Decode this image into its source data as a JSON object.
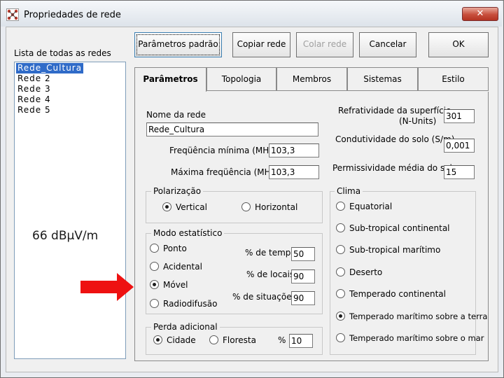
{
  "window": {
    "title": "Propriedades de rede",
    "close_label": "✕"
  },
  "sidebar": {
    "list_label": "Lista de todas as redes",
    "items": [
      "Rede_Cultura",
      "Rede 2",
      "Rede 3",
      "Rede 4",
      "Rede 5"
    ],
    "selected_index": 0
  },
  "toolbar": {
    "default_params": "Parâmetros padrão",
    "copy": "Copiar rede",
    "paste": "Colar rede",
    "cancel": "Cancelar",
    "ok": "OK"
  },
  "tabs": [
    "Parâmetros",
    "Topologia",
    "Membros",
    "Sistemas",
    "Estilo"
  ],
  "active_tab": "Parâmetros",
  "params": {
    "net_name_label": "Nome da rede",
    "net_name_value": "Rede_Cultura",
    "freq_min_label": "Freqüência mínima (MHz)",
    "freq_min_value": "103,3",
    "freq_max_label": "Máxima freqüência (MHz)",
    "freq_max_value": "103,3",
    "refractivity_label_1": "Refratividade da superfície",
    "refractivity_label_2": "(N-Units)",
    "refractivity_value": "301",
    "conductivity_label": "Condutividade do solo (S/m)",
    "conductivity_value": "0,001",
    "permittivity_label": "Permissividade média do solo",
    "permittivity_value": "15"
  },
  "polarization": {
    "title": "Polarização",
    "vertical": "Vertical",
    "horizontal": "Horizontal",
    "selected": "Vertical"
  },
  "statistic": {
    "title": "Modo estatístico",
    "options": [
      "Ponto",
      "Acidental",
      "Móvel",
      "Radiodifusão"
    ],
    "selected": "Móvel",
    "time_label": "% de tempo",
    "time_value": "50",
    "locations_label": "% de locais",
    "locations_value": "90",
    "situations_label": "% de situações",
    "situations_value": "90"
  },
  "loss": {
    "title": "Perda adicional",
    "city": "Cidade",
    "forest": "Floresta",
    "selected": "Cidade",
    "percent_label": "%",
    "percent_value": "10"
  },
  "climate": {
    "title": "Clima",
    "options": [
      "Equatorial",
      "Sub-tropical continental",
      "Sub-tropical marítimo",
      "Deserto",
      "Temperado continental",
      "Temperado marítimo sobre a terra",
      "Temperado marítimo sobre o mar"
    ],
    "selected": "Temperado marítimo sobre a terra"
  },
  "annotation": {
    "text": "66 dBµV/m",
    "arrow_color": "#ee1111"
  }
}
